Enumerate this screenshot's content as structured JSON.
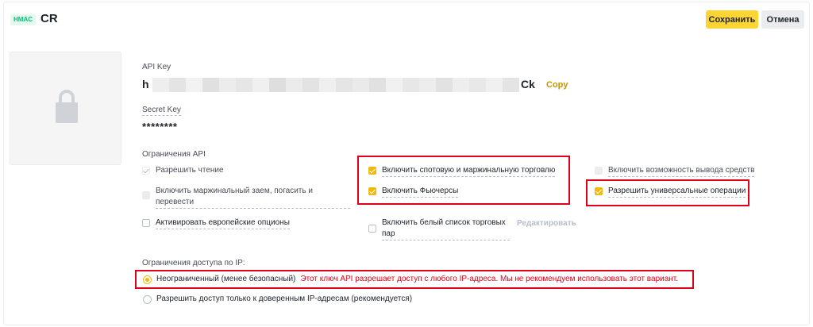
{
  "header": {
    "badge": "HMAC",
    "title": "CR",
    "save_label": "Сохранить",
    "cancel_label": "Отмена"
  },
  "api_key": {
    "label": "API Key",
    "prefix": "h",
    "suffix": "Ck",
    "copy_label": "Copy"
  },
  "secret_key": {
    "label": "Secret Key",
    "value": "********"
  },
  "restrictions": {
    "label": "Ограничения API",
    "read": "Разрешить чтение",
    "margin_loan": "Включить маржинальный заем, погасить и перевести",
    "eu_options": "Активировать европейские опционы",
    "spot_margin": "Включить спотовую и маржинальную торговлю",
    "futures": "Включить Фьючерсы",
    "whitelist": "Включить белый список торговых пар",
    "edit_label": "Редактировать",
    "withdraw": "Включить возможность вывода средств",
    "universal": "Разрешить универсальные операции"
  },
  "ip_access": {
    "label": "Ограничения доступа по IP:",
    "unrestricted": "Неограниченный (менее безопасный)",
    "warning": "Этот ключ API разрешает доступ с любого IP-адреса. Мы не рекомендуем использовать этот вариант.",
    "trusted": "Разрешить доступ только к доверенным IP-адресам (рекомендуется)"
  },
  "colors": {
    "accent": "#fcd535",
    "checkbox": "#f0b90b",
    "highlight": "#e0001a",
    "copy": "#c99400"
  }
}
